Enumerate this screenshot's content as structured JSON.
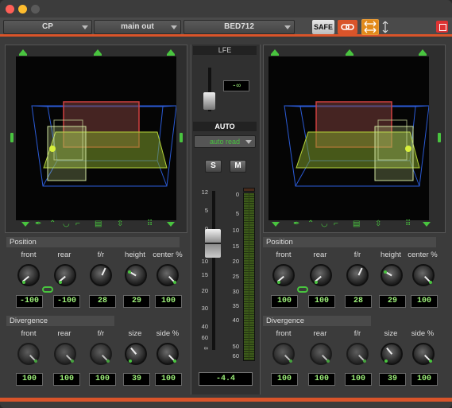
{
  "toolbar": {
    "dropdown_1": "CP",
    "dropdown_2": "main out",
    "dropdown_3": "BED712",
    "safe_label": "SAFE",
    "accent_color": "#d9542a"
  },
  "lfe": {
    "title": "LFE",
    "value": "-∞"
  },
  "automation": {
    "title": "AUTO",
    "mode": "auto read",
    "solo_label": "S",
    "mute_label": "M"
  },
  "fader": {
    "scale": [
      "12",
      "5",
      "0",
      "5",
      "10",
      "15",
      "20",
      "30",
      "40",
      "60",
      "∞"
    ],
    "meter_scale": [
      "0",
      "5",
      "10",
      "15",
      "20",
      "25",
      "30",
      "35",
      "40",
      "50",
      "60"
    ],
    "value": "-4.4"
  },
  "left": {
    "position_title": "Position",
    "divergence_title": "Divergence",
    "position_labels": [
      "front",
      "rear",
      "f/r",
      "height",
      "center %"
    ],
    "position_values": [
      "-100",
      "-100",
      "28",
      "29",
      "100"
    ],
    "divergence_labels": [
      "front",
      "rear",
      "f/r",
      "size",
      "side %"
    ],
    "divergence_values": [
      "100",
      "100",
      "100",
      "39",
      "100"
    ]
  },
  "right": {
    "position_title": "Position",
    "divergence_title": "Divergence",
    "position_labels": [
      "front",
      "rear",
      "f/r",
      "height",
      "center %"
    ],
    "position_values": [
      "100",
      "100",
      "28",
      "29",
      "100"
    ],
    "divergence_labels": [
      "front",
      "rear",
      "f/r",
      "size",
      "side %"
    ],
    "divergence_values": [
      "100",
      "100",
      "100",
      "39",
      "100"
    ]
  },
  "icons": {
    "link": "chain-link-icon",
    "orientation": "horizontal-arrows-icon",
    "close": "close-icon"
  }
}
